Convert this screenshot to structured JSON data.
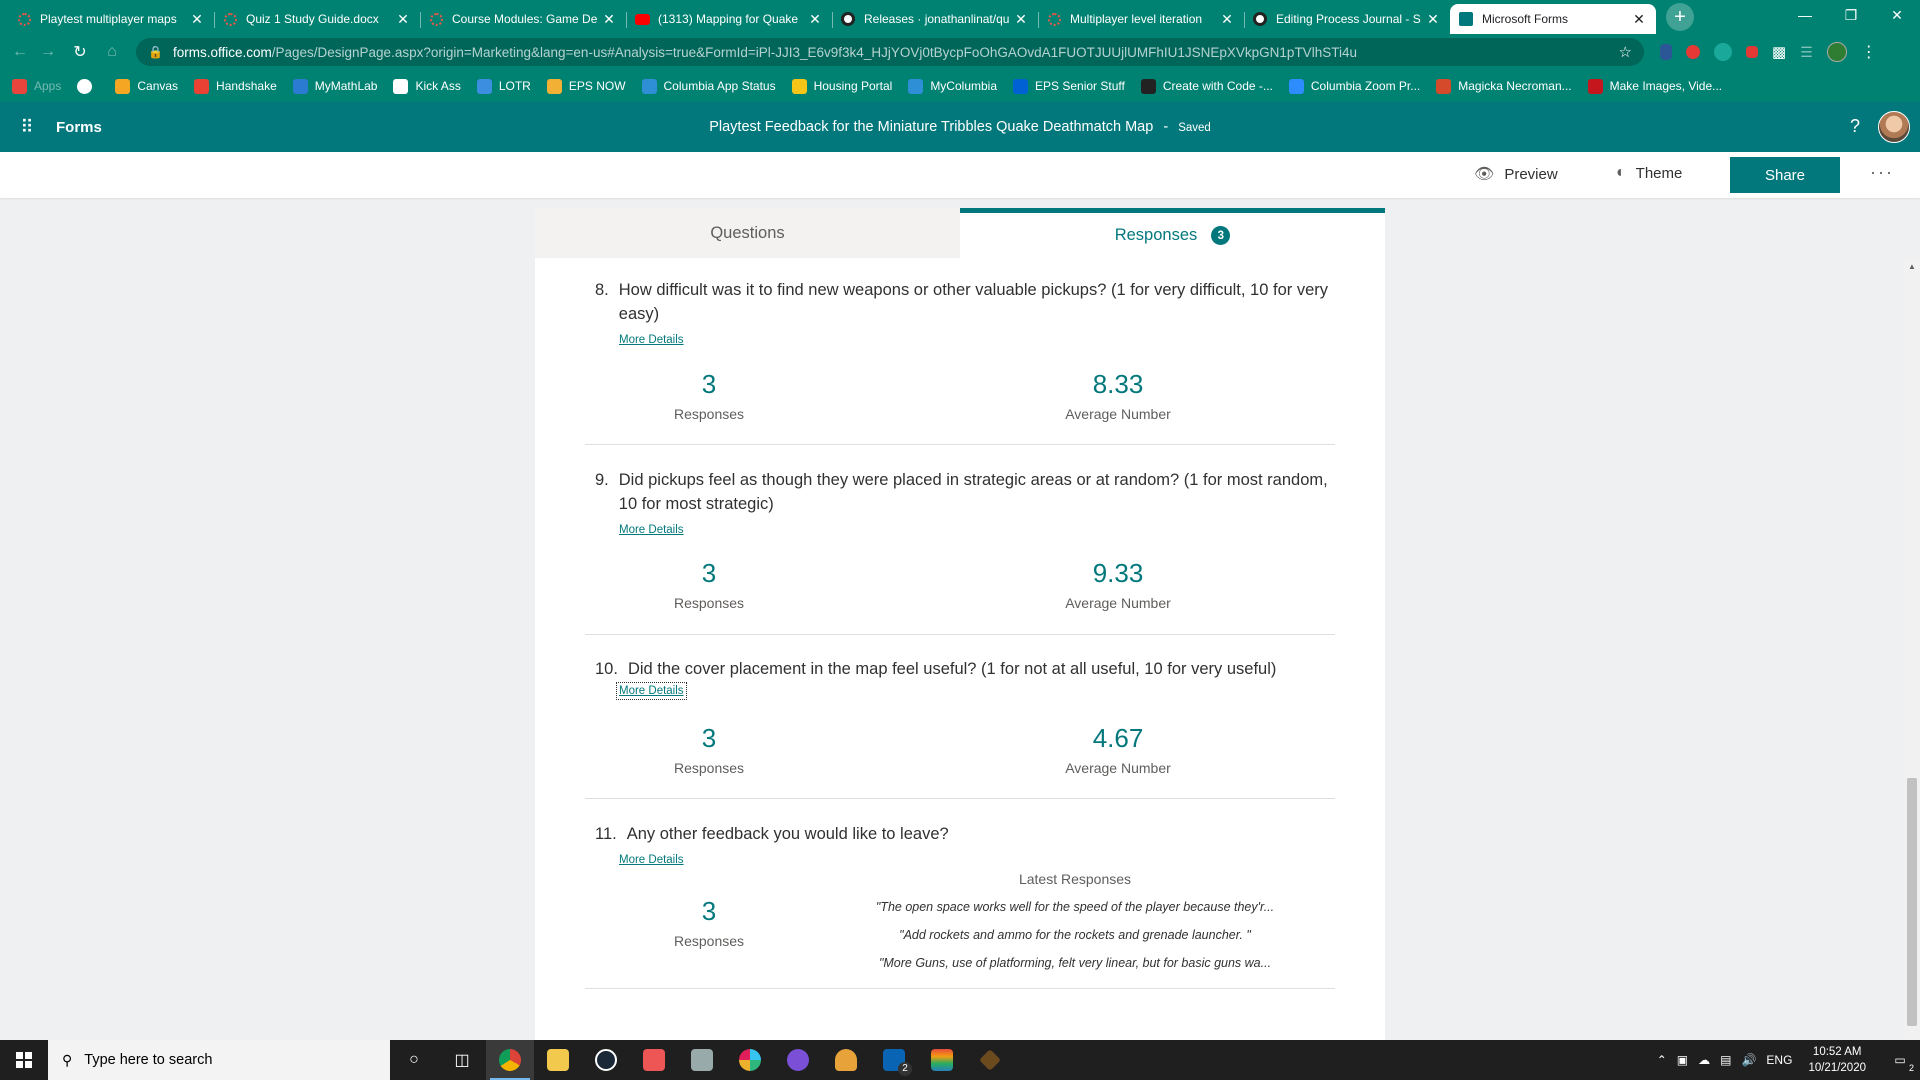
{
  "browser": {
    "tabs": [
      {
        "title": "Playtest multiplayer maps",
        "icon": "forms-ring-icon"
      },
      {
        "title": "Quiz 1 Study Guide.docx",
        "icon": "forms-ring-icon"
      },
      {
        "title": "Course Modules: Game De",
        "icon": "forms-ring-icon"
      },
      {
        "title": "(1313) Mapping for Quake",
        "icon": "youtube-icon"
      },
      {
        "title": "Releases · jonathanlinat/qu",
        "icon": "github-icon"
      },
      {
        "title": "Multiplayer level iteration",
        "icon": "forms-ring-icon"
      },
      {
        "title": "Editing Process Journal - S",
        "icon": "github-icon"
      },
      {
        "title": "Microsoft Forms",
        "icon": "ms-forms-icon",
        "active": true
      }
    ],
    "close_glyph": "✕",
    "new_tab_glyph": "+",
    "url_host": "forms.office.com",
    "url_path": "/Pages/DesignPage.aspx?origin=Marketing&lang=en-us#Analysis=true&FormId=iPl-JJI3_E6v9f3k4_HJjYOVj0tBycpFoOhGAOvdA1FUOTJUUjlUMFhIU1JSNEpXVkpGN1pTVlhSTi4u",
    "bookmarks": [
      {
        "label": "Apps",
        "color": "#e8453c",
        "dim": true
      },
      {
        "label": "",
        "color": "#ffffff"
      },
      {
        "label": "Canvas",
        "color": "#f5a623"
      },
      {
        "label": "Handshake",
        "color": "#e94234"
      },
      {
        "label": "MyMathLab",
        "color": "#2b7bd3"
      },
      {
        "label": "Kick Ass",
        "color": "#ffffff"
      },
      {
        "label": "LOTR",
        "color": "#3b8ee0"
      },
      {
        "label": "EPS NOW",
        "color": "#f2b134"
      },
      {
        "label": "Columbia App Status",
        "color": "#2f8fd6"
      },
      {
        "label": "Housing Portal",
        "color": "#f5c518"
      },
      {
        "label": "MyColumbia",
        "color": "#2f8fd6"
      },
      {
        "label": "EPS Senior Stuff",
        "color": "#0061d5"
      },
      {
        "label": "Create with Code -...",
        "color": "#222222"
      },
      {
        "label": "Columbia Zoom Pr...",
        "color": "#2d8cff"
      },
      {
        "label": "Magicka Necroman...",
        "color": "#d44a2a"
      },
      {
        "label": "Make Images, Vide...",
        "color": "#c4161c"
      }
    ]
  },
  "forms_header": {
    "app_name": "Forms",
    "form_title": "Playtest Feedback for the Miniature Tribbles Quake Deathmatch Map",
    "separator": "-",
    "save_status": "Saved",
    "help_label": "?"
  },
  "commands": {
    "preview": "Preview",
    "theme": "Theme",
    "share": "Share",
    "more": "···"
  },
  "view_tabs": {
    "questions": "Questions",
    "responses": "Responses",
    "response_count": "3"
  },
  "more_details": "More Details",
  "questions": [
    {
      "number": "8.",
      "text": "How difficult was it to find new weapons or other valuable pickups? (1 for very difficult, 10 for very easy)",
      "responses": "3",
      "responses_label": "Responses",
      "average": "8.33",
      "average_label": "Average Number"
    },
    {
      "number": "9.",
      "text": "Did pickups feel as though they were placed in strategic areas or at random? (1 for most random, 10 for most strategic)",
      "responses": "3",
      "responses_label": "Responses",
      "average": "9.33",
      "average_label": "Average Number"
    },
    {
      "number": "10.",
      "text": "Did the cover placement in the map feel useful? (1 for not at all useful, 10 for very useful)",
      "responses": "3",
      "responses_label": "Responses",
      "average": "4.67",
      "average_label": "Average Number"
    },
    {
      "number": "11.",
      "text": "Any other feedback you would like to leave?",
      "responses": "3",
      "responses_label": "Responses",
      "latest_label": "Latest Responses",
      "latest": [
        "\"The open space works well for the speed of the player because they'r...",
        "\"Add rockets and ammo for the rockets and grenade launcher. \"",
        "\"More Guns, use of platforming, felt very linear, but for basic guns wa..."
      ]
    }
  ],
  "taskbar": {
    "search_placeholder": "Type here to search",
    "language": "ENG",
    "time": "10:52 AM",
    "date": "10/21/2020",
    "mail_badge": "2",
    "notification_badge": "2"
  }
}
